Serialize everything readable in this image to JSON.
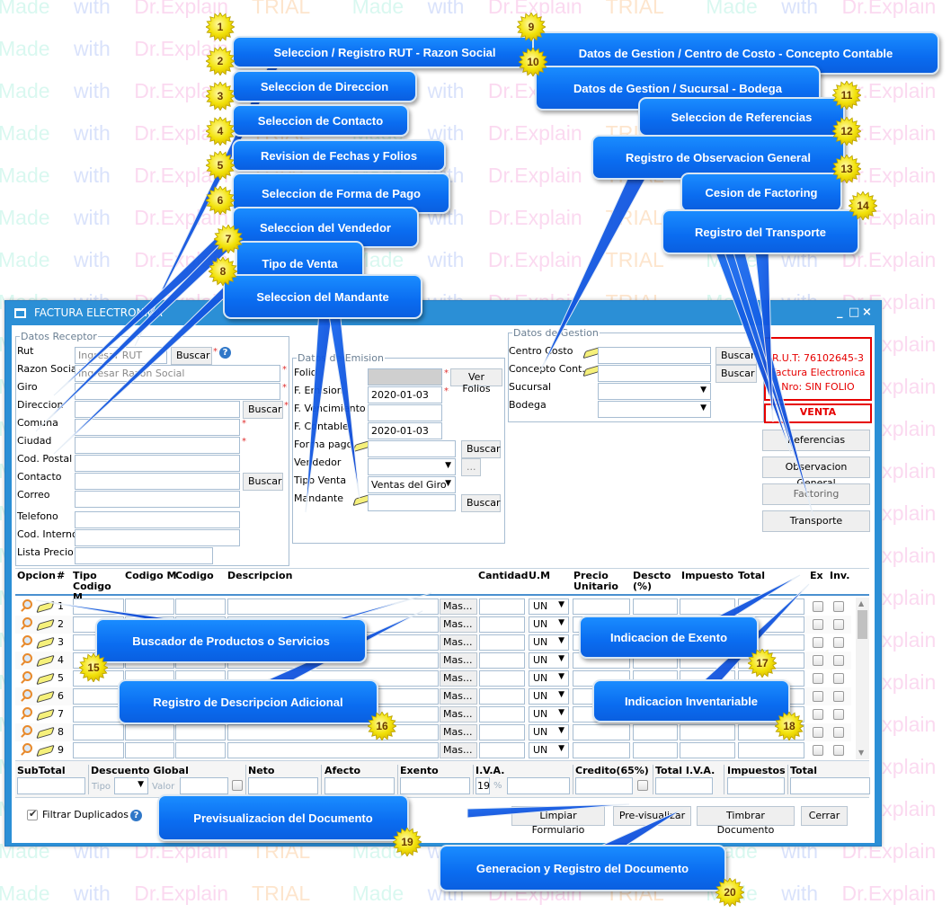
{
  "watermark": "Made with Dr.Explain TRIAL",
  "window": {
    "title": "FACTURA ELECTRONICA",
    "controls": [
      "_",
      "□",
      "×"
    ]
  },
  "receptor": {
    "legend": "Datos Receptor",
    "rut_label": "Rut",
    "rut_placeholder": "Ingresar RUT",
    "razon_label": "Razon Social",
    "razon_placeholder": "Ingresar Razón Social",
    "giro_label": "Giro",
    "direccion_label": "Direccion",
    "comuna_label": "Comuna",
    "ciudad_label": "Ciudad",
    "postal_label": "Cod. Postal",
    "contacto_label": "Contacto",
    "correo_label": "Correo",
    "telefono_label": "Telefono",
    "interno_label": "Cod. Interno",
    "lista_label": "Lista Precio",
    "buscar": "Buscar",
    "required": "*",
    "help": "?"
  },
  "emision": {
    "legend": "Datos de Emision",
    "folio_label": "Folio",
    "ver_folios": "Ver Folios",
    "f_emision_label": "F. Emision",
    "f_emision_value": "2020-01-03",
    "f_vencimiento_label": "F. Vencimiento",
    "f_contable_label": "F. Contable",
    "f_contable_value": "2020-01-03",
    "forma_pago_label": "Forma pago",
    "vendedor_label": "Vendedor",
    "tipo_venta_label": "Tipo Venta",
    "tipo_venta_value": "Ventas del Giro",
    "mandante_label": "Mandante",
    "buscar": "Buscar",
    "ellipsis": "...",
    "arrow": "▼"
  },
  "gestion": {
    "legend": "Datos de Gestion",
    "centro_label": "Centro Costo",
    "concepto_label": "Concepto Cont.",
    "sucursal_label": "Sucursal",
    "bodega_label": "Bodega",
    "buscar": "Buscar"
  },
  "doc_info": {
    "rut": "R.U.T: 76102645-3",
    "tipo": "Factura Electronica",
    "nro": "Nro: SIN FOLIO",
    "venta": "VENTA",
    "brand_color": "#e60000"
  },
  "side_buttons": [
    "Referencias",
    "Observacion General",
    "Factoring",
    "Transporte"
  ],
  "grid": {
    "headers": [
      "Opcion",
      "#",
      "Tipo Codigo M",
      "Codigo M",
      "Codigo",
      "Descripcion",
      "Cantidad",
      "U.M",
      "Precio Unitario",
      "Descto (%)",
      "Impuesto",
      "Total",
      "Ex",
      "Inv."
    ],
    "rows": [
      {
        "n": "1",
        "um": "UN",
        "mas": "Mas..."
      },
      {
        "n": "2",
        "um": "UN",
        "mas": "Mas..."
      },
      {
        "n": "3",
        "um": "UN",
        "mas": "Mas..."
      },
      {
        "n": "4",
        "um": "UN",
        "mas": "Mas..."
      },
      {
        "n": "5",
        "um": "UN",
        "mas": "Mas..."
      },
      {
        "n": "6",
        "um": "UN",
        "mas": "Mas..."
      },
      {
        "n": "7",
        "um": "UN",
        "mas": "Mas..."
      },
      {
        "n": "8",
        "um": "UN",
        "mas": "Mas..."
      },
      {
        "n": "9",
        "um": "UN",
        "mas": "Mas..."
      }
    ]
  },
  "totals": {
    "subtotal": "SubTotal",
    "descuento": "Descuento Global",
    "tipo": "Tipo",
    "valor": "Valor",
    "neto": "Neto",
    "afecto": "Afecto",
    "exento": "Exento",
    "iva": "I.V.A.",
    "iva_rate": "19",
    "percent": "%",
    "credito": "Credito(65%)",
    "total_iva": "Total I.V.A.",
    "impuestos": "Impuestos",
    "total": "Total"
  },
  "footer": {
    "filtrar": "Filtrar Duplicados",
    "filtrar_checked": true,
    "limpiar": "Limpiar Formulario",
    "previsualizar": "Pre-visualizar",
    "timbrar": "Timbrar Documento",
    "cerrar": "Cerrar"
  },
  "callouts": [
    {
      "n": "1",
      "text": "Seleccion / Registro RUT - Razon Social"
    },
    {
      "n": "2",
      "text": "Seleccion de Direccion"
    },
    {
      "n": "3",
      "text": "Seleccion de Contacto"
    },
    {
      "n": "4",
      "text": "Revision de Fechas y Folios"
    },
    {
      "n": "5",
      "text": "Seleccion de Forma de Pago"
    },
    {
      "n": "6",
      "text": "Seleccion del Vendedor"
    },
    {
      "n": "7",
      "text": "Tipo de Venta"
    },
    {
      "n": "8",
      "text": "Seleccion del Mandante"
    },
    {
      "n": "9",
      "text": "Datos de Gestion / Centro de Costo - Concepto Contable"
    },
    {
      "n": "10",
      "text": "Datos de Gestion / Sucursal - Bodega"
    },
    {
      "n": "11",
      "text": "Seleccion de Referencias"
    },
    {
      "n": "12",
      "text": "Registro de Observacion General"
    },
    {
      "n": "13",
      "text": "Cesion de Factoring"
    },
    {
      "n": "14",
      "text": "Registro del Transporte"
    },
    {
      "n": "15",
      "text": "Buscador de Productos o Servicios"
    },
    {
      "n": "16",
      "text": "Registro de Descripcion Adicional"
    },
    {
      "n": "17",
      "text": "Indicacion de Exento"
    },
    {
      "n": "18",
      "text": "Indicacion Inventariable"
    },
    {
      "n": "19",
      "text": "Previsualizacion del Documento"
    },
    {
      "n": "20",
      "text": "Generacion y Registro del Documento"
    }
  ]
}
